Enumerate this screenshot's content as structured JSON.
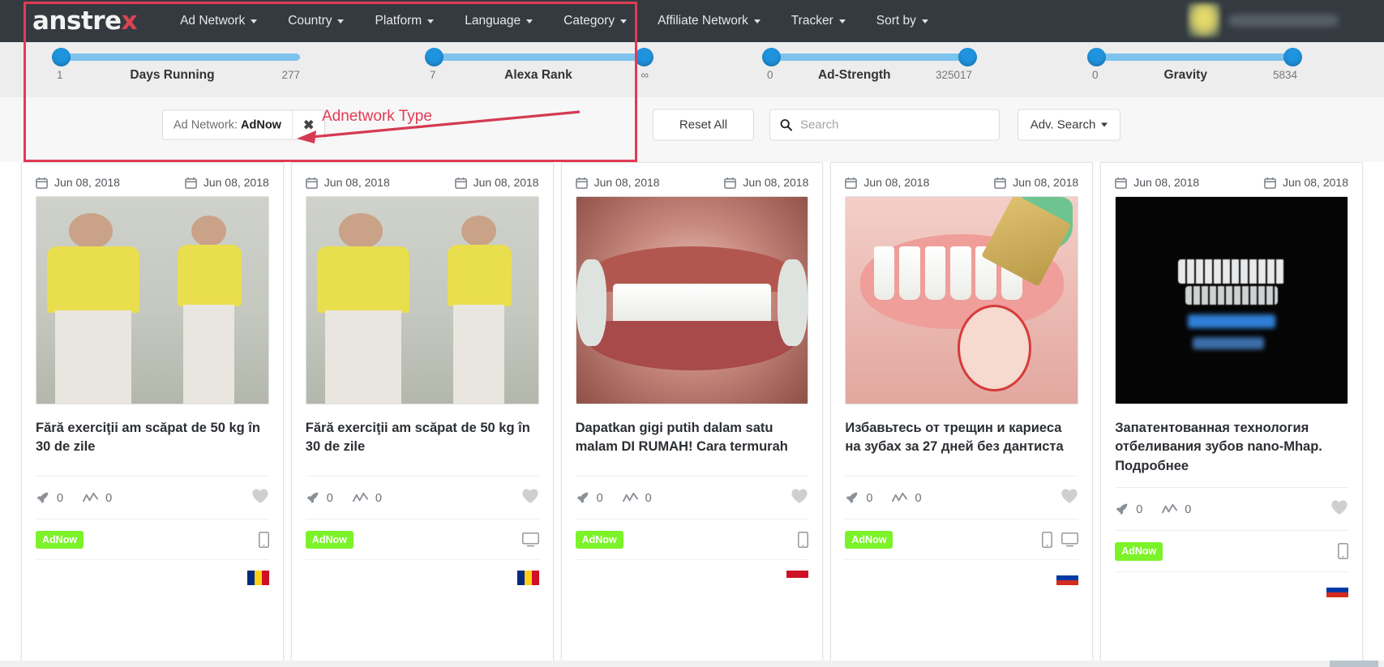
{
  "navbar": {
    "logo_main": "anstre",
    "logo_accent": "x",
    "items": [
      {
        "label": "Ad Network"
      },
      {
        "label": "Country"
      },
      {
        "label": "Platform"
      },
      {
        "label": "Language"
      },
      {
        "label": "Category"
      },
      {
        "label": "Affiliate Network"
      },
      {
        "label": "Tracker"
      },
      {
        "label": "Sort by"
      }
    ]
  },
  "sliders": [
    {
      "name": "Days Running",
      "min": "1",
      "max": "277",
      "left_pct": 0,
      "right_pct": 100,
      "handles": 1
    },
    {
      "name": "Alexa Rank",
      "min": "7",
      "max": "∞",
      "left_pct": 0,
      "right_pct": 100,
      "handles": 2
    },
    {
      "name": "Ad-Strength",
      "min": "0",
      "max": "325017",
      "left_pct": 0,
      "right_pct": 100,
      "handles": 2
    },
    {
      "name": "Gravity",
      "min": "0",
      "max": "5834",
      "left_pct": 0,
      "right_pct": 100,
      "handles": 2
    }
  ],
  "filters": {
    "chip_prefix": "Ad Network:",
    "chip_value": "AdNow",
    "chip_close": "✖",
    "reset_label": "Reset All",
    "search_placeholder": "Search",
    "search_value": "",
    "adv_search_label": "Adv. Search"
  },
  "annotation": {
    "label": "Adnetwork Type",
    "color": "#e23b54"
  },
  "cards": [
    {
      "date_start": "Jun 08, 2018",
      "date_end": "Jun 08, 2018",
      "title": "Fără exerciţii am scăpat de 50 kg în 30 de zile",
      "launches": "0",
      "trend": "0",
      "network": "AdNow",
      "devices": [
        "mobile"
      ],
      "country": "Romania",
      "image_kind": "before-after-woman"
    },
    {
      "date_start": "Jun 08, 2018",
      "date_end": "Jun 08, 2018",
      "title": "Fără exerciţii am scăpat de 50 kg în 30 de zile",
      "launches": "0",
      "trend": "0",
      "network": "AdNow",
      "devices": [
        "desktop"
      ],
      "country": "Romania",
      "image_kind": "before-after-woman"
    },
    {
      "date_start": "Jun 08, 2018",
      "date_end": "Jun 08, 2018",
      "title": "Dapatkan gigi putih dalam satu malam DI RUMAH! Cara termurah",
      "launches": "0",
      "trend": "0",
      "network": "AdNow",
      "devices": [
        "mobile"
      ],
      "country": "Indonesia",
      "image_kind": "teeth-photo"
    },
    {
      "date_start": "Jun 08, 2018",
      "date_end": "Jun 08, 2018",
      "title": "Избавьтесь от трещин и кариеса на зубах за 27 дней без дантиста",
      "launches": "0",
      "trend": "0",
      "network": "AdNow",
      "devices": [
        "mobile",
        "desktop"
      ],
      "country": "Russia",
      "image_kind": "mouth-illustration"
    },
    {
      "date_start": "Jun 08, 2018",
      "date_end": "Jun 08, 2018",
      "title": "Запатентованная технология отбеливания зубов nano-Mhap. Подробнее",
      "launches": "0",
      "trend": "0",
      "network": "AdNow",
      "devices": [
        "mobile"
      ],
      "country": "Russia",
      "image_kind": "dark-teeth"
    }
  ]
}
